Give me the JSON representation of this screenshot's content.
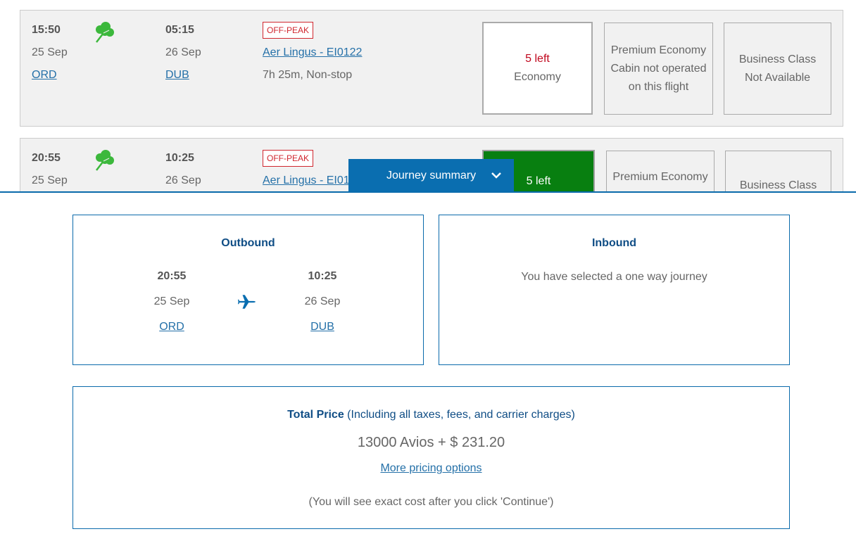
{
  "flights": [
    {
      "departure": {
        "time": "15:50",
        "date": "25 Sep",
        "airport": "ORD"
      },
      "arrival": {
        "time": "05:15",
        "date": "26 Sep",
        "airport": "DUB"
      },
      "fare_badge": "OFF-PEAK",
      "flight_link": "Aer Lingus - EI0122",
      "duration": "7h 25m, Non-stop",
      "airline_icon": "shamrock-icon",
      "cabins": {
        "economy": {
          "seats": "5 left",
          "label": "Economy"
        },
        "premium": {
          "label": "Premium Economy",
          "status_line1": "Cabin not operated",
          "status_line2": "on this flight"
        },
        "business": {
          "label": "Business Class",
          "status": "Not Available"
        }
      }
    },
    {
      "departure": {
        "time": "20:55",
        "date": "25 Sep",
        "airport": "ORD"
      },
      "arrival": {
        "time": "10:25",
        "date": "26 Sep",
        "airport": "DUB"
      },
      "fare_badge": "OFF-PEAK",
      "flight_link": "Aer Lingus - EI01",
      "airline_icon": "shamrock-icon",
      "cabins": {
        "economy": {
          "seats": "5 left"
        },
        "premium": {
          "label": "Premium Economy"
        },
        "business": {
          "label": "Business Class"
        }
      }
    }
  ],
  "summary_tab": {
    "label": "Journey summary",
    "icon": "chevron-down-icon"
  },
  "outbound": {
    "title": "Outbound",
    "departure": {
      "time": "20:55",
      "date": "25 Sep",
      "airport": "ORD"
    },
    "arrival": {
      "time": "10:25",
      "date": "26 Sep",
      "airport": "DUB"
    },
    "icon": "plane-icon"
  },
  "inbound": {
    "title": "Inbound",
    "message": "You have selected a one way journey"
  },
  "price": {
    "title": "Total Price",
    "subtitle": "(Including all taxes, fees, and carrier charges)",
    "amount": "13000 Avios + $ 231.20",
    "more_options": "More pricing options",
    "note": "(You will see exact cost after you click 'Continue')"
  },
  "colors": {
    "brand_blue": "#0a6eb0",
    "selected_green": "#087f10",
    "offpeak_red": "#d0262e",
    "seats_left_red": "#c0061c",
    "shamrock_green": "#3cb83c"
  }
}
